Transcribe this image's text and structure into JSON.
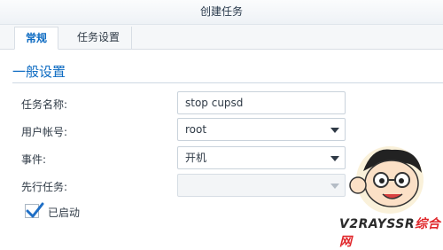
{
  "window": {
    "title": "创建任务"
  },
  "tabs": [
    {
      "label": "常规",
      "active": true
    },
    {
      "label": "任务设置",
      "active": false
    }
  ],
  "section": {
    "title": "一般设置"
  },
  "form": {
    "task_name": {
      "label": "任务名称:",
      "value": "stop cupsd"
    },
    "user": {
      "label": "用户帐号:",
      "value": "root"
    },
    "event": {
      "label": "事件:",
      "value": "开机"
    },
    "pre_task": {
      "label": "先行任务:",
      "value": ""
    },
    "enabled": {
      "label": "已启动",
      "checked": true
    }
  },
  "watermark": {
    "text_main": "V2RAYSSR",
    "text_accent": "综合网"
  },
  "colors": {
    "accent": "#0d6bc2",
    "check": "#1f6fc6"
  },
  "icons": [
    "chevron-down-icon",
    "checkmark-icon",
    "mascot-logo"
  ]
}
